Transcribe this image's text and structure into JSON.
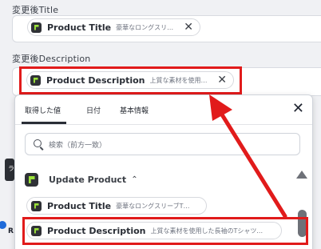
{
  "title_field": {
    "label": "変更後Title",
    "chip": {
      "title": "Product Title",
      "preview": "豪華なロングスリーブTシャツ"
    }
  },
  "description_field": {
    "label": "変更後Description",
    "chip": {
      "title": "Product Description",
      "preview": "上質な素材を使用した長袖のTシャツ"
    }
  },
  "dropdown": {
    "tabs": [
      "取得した値",
      "日付",
      "基本情報"
    ],
    "active_tab": "取得した値",
    "search_placeholder": "検索（前方一致）",
    "group": {
      "title": "Update Product",
      "items": [
        {
          "title": "Product Title",
          "preview": "豪華なロングスリーブTシャツ"
        },
        {
          "title": "Product Description",
          "preview": "上質な素材を使用した長袖のTシャツ。肌..."
        }
      ]
    }
  },
  "colors": {
    "highlight": "#e11b1b",
    "logo_bg": "#2f3136",
    "logo_accent": "#9be23a"
  },
  "icons": {
    "chip_remove": "close-icon",
    "dropdown_close": "close-icon",
    "search": "search-icon",
    "group_toggle": "chevron-up-icon"
  }
}
